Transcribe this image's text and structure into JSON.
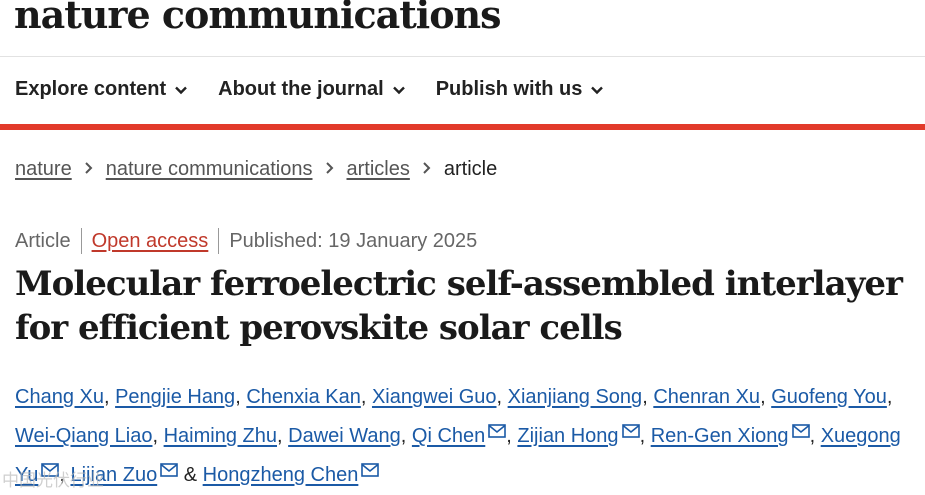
{
  "brand": "nature communications",
  "nav": [
    {
      "label": "Explore content"
    },
    {
      "label": "About the journal"
    },
    {
      "label": "Publish with us"
    }
  ],
  "breadcrumb": {
    "items": [
      "nature",
      "nature communications",
      "articles"
    ],
    "current": "article"
  },
  "meta": {
    "type": "Article",
    "access": "Open access",
    "published": "Published: 19 January 2025"
  },
  "article_title": "Molecular ferroelectric self-assembled interlayer for efficient perovskite solar cells",
  "authors": [
    {
      "name": "Chang Xu"
    },
    {
      "name": "Pengjie Hang"
    },
    {
      "name": "Chenxia Kan"
    },
    {
      "name": "Xiangwei Guo"
    },
    {
      "name": "Xianjiang Song"
    },
    {
      "name": "Chenran Xu"
    },
    {
      "name": "Guofeng You"
    },
    {
      "name": "Wei-Qiang Liao"
    },
    {
      "name": "Haiming Zhu"
    },
    {
      "name": "Dawei Wang"
    },
    {
      "name": "Qi Chen"
    },
    {
      "name": "Zijian Hong"
    },
    {
      "name": "Ren-Gen Xiong"
    },
    {
      "name": "Xuegong Yu"
    },
    {
      "name": "Lijian Zuo"
    },
    {
      "name": "Hongzheng Chen"
    }
  ],
  "author_sep": ", ",
  "author_and": " & ",
  "watermark": "中国光伏行业",
  "colors": {
    "accent_bar": "#e23a2a",
    "link": "#1b5aa6",
    "open_access": "#c0392b"
  }
}
